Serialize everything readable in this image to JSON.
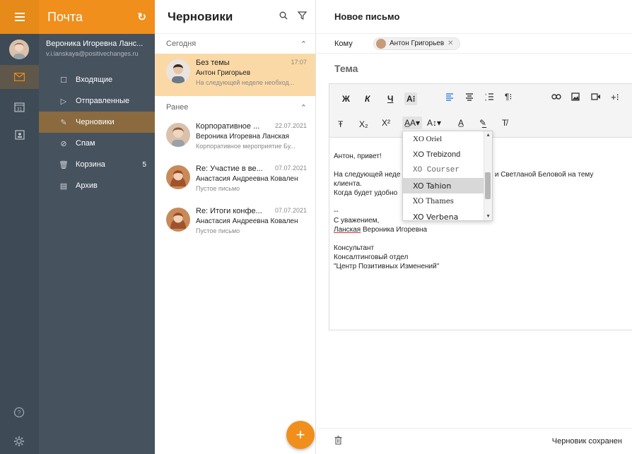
{
  "rail": {
    "items": [
      {
        "icon": "mail-icon"
      },
      {
        "icon": "calendar-icon",
        "text": "31"
      },
      {
        "icon": "contacts-icon"
      }
    ],
    "bottom": [
      "help-icon",
      "settings-icon"
    ]
  },
  "folders": {
    "title": "Почта",
    "account_name": "Вероника Игоревна Ланс...",
    "account_email": "v.i.lanskaya@positivechanges.ru",
    "items": [
      {
        "label": "Входящие",
        "icon": "☐"
      },
      {
        "label": "Отправленные",
        "icon": "▷"
      },
      {
        "label": "Черновики",
        "icon": "✎"
      },
      {
        "label": "Спам",
        "icon": "⊘"
      },
      {
        "label": "Корзина",
        "icon": "🗑",
        "badge": "5"
      },
      {
        "label": "Архив",
        "icon": "▤"
      }
    ]
  },
  "list": {
    "title": "Черновики",
    "group_today": "Сегодня",
    "group_earlier": "Ранее",
    "messages": [
      {
        "subject": "Без темы",
        "date": "17:07",
        "from": "Антон Григорьев",
        "preview": "На следующей неделе необход..."
      },
      {
        "subject": "Корпоративное ...",
        "date": "22.07.2021",
        "from": "Вероника Игоревна Ланская",
        "preview": "Корпоративное мероприятие Бу..."
      },
      {
        "subject": "Re: Участие в ве...",
        "date": "07.07.2021",
        "from": "Анастасия Андреевна Ковален",
        "preview": "Пустое письмо"
      },
      {
        "subject": "Re: Итоги конфе...",
        "date": "07.07.2021",
        "from": "Анастасия Андреевна Ковален",
        "preview": "Пустое письмо"
      }
    ],
    "fab": "+"
  },
  "compose": {
    "title": "Новое письмо",
    "to_label": "Кому",
    "recipient": "Антон Григорьев",
    "subject_placeholder": "Тема",
    "toolbar_row1": [
      "Ж",
      "К",
      "Ч",
      "A⁝"
    ],
    "toolbar_row2": [
      "Ŧ",
      "X₂",
      "X²",
      "A̲A▾",
      "A↕▾",
      "A̲",
      "✎̲",
      "T̸"
    ],
    "body": {
      "l1": "Антон, привет!",
      "l2a": "На следующей неде",
      "l2b": "с тобой и Светланой Беловой на тему",
      "l3": "клиента.",
      "l4": "Когда будет удобно",
      "l5": "--",
      "l6": "С уважением,",
      "l7a": "Ланская",
      "l7b": " Вероника Игоревна",
      "l8": "Консультант",
      "l9": "Консалтинговый отдел",
      "l10": "\"Центр Позитивных Изменений\""
    },
    "font_dropdown": {
      "options": [
        "XO Oriel",
        "XO Trebizond",
        "XO Courser",
        "XO Tahion",
        "XO Thames",
        "XO Verbena"
      ],
      "selected": "XO Tahion"
    },
    "status": "Черновик сохранен"
  }
}
